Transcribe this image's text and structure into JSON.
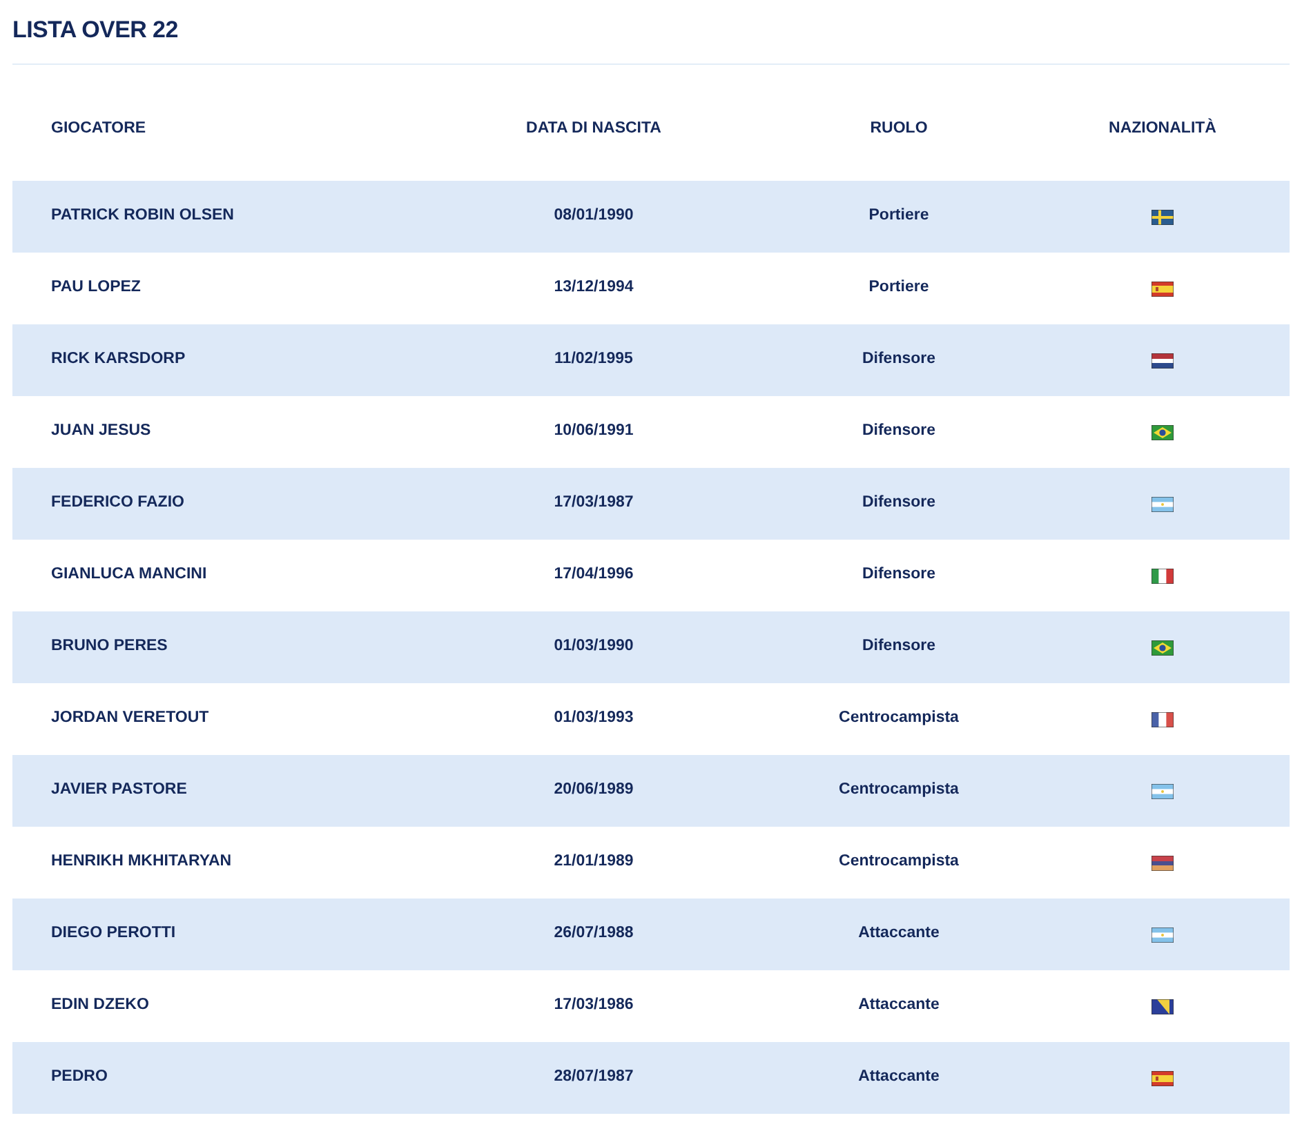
{
  "title": "LISTA OVER 22",
  "table": {
    "columns": [
      "GIOCATORE",
      "DATA DI NASCITA",
      "RUOLO",
      "NAZIONALITÀ"
    ],
    "rows": [
      {
        "name": "PATRICK ROBIN OLSEN",
        "birth_date": "08/01/1990",
        "role": "Portiere",
        "kind": "se"
      },
      {
        "name": "PAU LOPEZ",
        "birth_date": "13/12/1994",
        "role": "Portiere",
        "kind": "es"
      },
      {
        "name": "RICK KARSDORP",
        "birth_date": "11/02/1995",
        "role": "Difensore",
        "kind": "nl"
      },
      {
        "name": "JUAN JESUS",
        "birth_date": "10/06/1991",
        "role": "Difensore",
        "kind": "br"
      },
      {
        "name": "FEDERICO FAZIO",
        "birth_date": "17/03/1987",
        "role": "Difensore",
        "kind": "ar"
      },
      {
        "name": "GIANLUCA MANCINI",
        "birth_date": "17/04/1996",
        "role": "Difensore",
        "kind": "it"
      },
      {
        "name": "BRUNO PERES",
        "birth_date": "01/03/1990",
        "role": "Difensore",
        "kind": "br"
      },
      {
        "name": "JORDAN VERETOUT",
        "birth_date": "01/03/1993",
        "role": "Centrocampista",
        "kind": "fr"
      },
      {
        "name": "JAVIER PASTORE",
        "birth_date": "20/06/1989",
        "role": "Centrocampista",
        "kind": "ar"
      },
      {
        "name": "HENRIKH MKHITARYAN",
        "birth_date": "21/01/1989",
        "role": "Centrocampista",
        "kind": "am"
      },
      {
        "name": "DIEGO PEROTTI",
        "birth_date": "26/07/1988",
        "role": "Attaccante",
        "kind": "ar"
      },
      {
        "name": "EDIN DZEKO",
        "birth_date": "17/03/1986",
        "role": "Attaccante",
        "kind": "ba"
      },
      {
        "name": "PEDRO",
        "birth_date": "28/07/1987",
        "role": "Attaccante",
        "kind": "es"
      }
    ]
  }
}
